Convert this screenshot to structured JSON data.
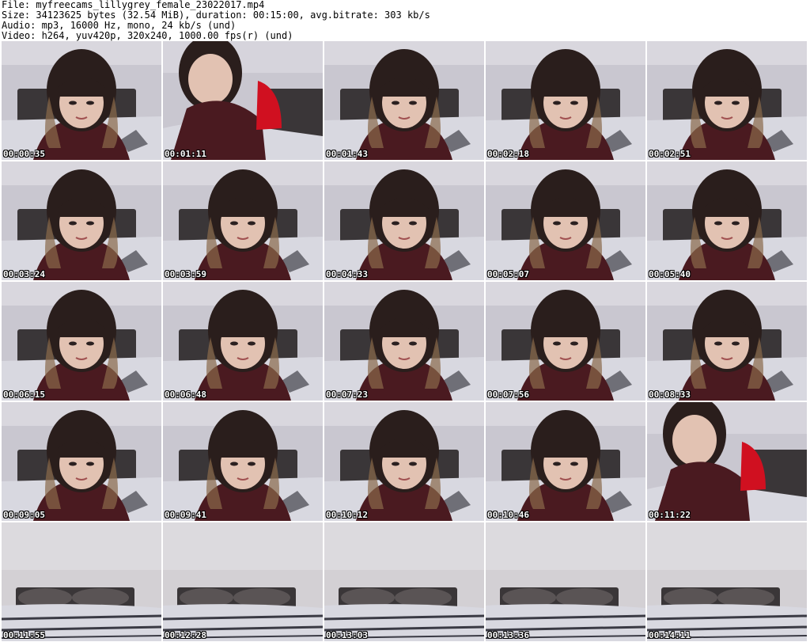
{
  "header": {
    "file_line": "File: myfreecams_lillygrey_female_23022017.mp4",
    "size_line": "Size: 34123625 bytes (32.54 MiB), duration: 00:15:00, avg.bitrate: 303 kb/s",
    "audio_line": "Audio: mp3, 16000 Hz, mono, 24 kb/s (und)",
    "video_line": "Video: h264, yuv420p, 320x240, 1000.00 fps(r) (und)"
  },
  "thumbnails": [
    {
      "time": "00:00:35",
      "scene": "person"
    },
    {
      "time": "00:01:11",
      "scene": "person-leaning"
    },
    {
      "time": "00:01:43",
      "scene": "person"
    },
    {
      "time": "00:02:18",
      "scene": "person"
    },
    {
      "time": "00:02:51",
      "scene": "person"
    },
    {
      "time": "00:03:24",
      "scene": "person"
    },
    {
      "time": "00:03:59",
      "scene": "person"
    },
    {
      "time": "00:04:33",
      "scene": "person"
    },
    {
      "time": "00:05:07",
      "scene": "person"
    },
    {
      "time": "00:05:40",
      "scene": "person"
    },
    {
      "time": "00:06:15",
      "scene": "person"
    },
    {
      "time": "00:06:48",
      "scene": "person"
    },
    {
      "time": "00:07:23",
      "scene": "person"
    },
    {
      "time": "00:07:56",
      "scene": "person"
    },
    {
      "time": "00:08:33",
      "scene": "person"
    },
    {
      "time": "00:09:05",
      "scene": "person"
    },
    {
      "time": "00:09:41",
      "scene": "person"
    },
    {
      "time": "00:10:12",
      "scene": "person"
    },
    {
      "time": "00:10:46",
      "scene": "person"
    },
    {
      "time": "00:11:22",
      "scene": "person-leaning"
    },
    {
      "time": "00:11:55",
      "scene": "empty-bed"
    },
    {
      "time": "00:12:28",
      "scene": "empty-bed"
    },
    {
      "time": "00:13:03",
      "scene": "empty-bed"
    },
    {
      "time": "00:13:36",
      "scene": "empty-bed"
    },
    {
      "time": "00:14:11",
      "scene": "empty-bed"
    }
  ],
  "colors": {
    "wall": "#c9c7d0",
    "headboard": "#3a3638",
    "bedding": "#d8d8e0",
    "hair": "#2a1e1c",
    "skin": "#e2c2b2",
    "sweater": "#4a1a20",
    "accent_red": "#d01020"
  }
}
